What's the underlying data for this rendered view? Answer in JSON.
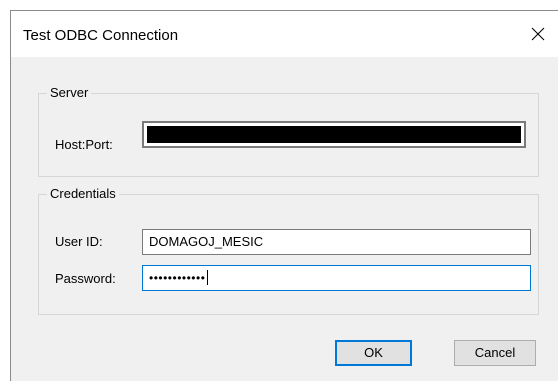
{
  "window": {
    "title": "Test ODBC Connection",
    "close_icon": "close-icon"
  },
  "server": {
    "group_label": "Server",
    "host_label": "Host:Port:",
    "host_value": ""
  },
  "credentials": {
    "group_label": "Credentials",
    "user_label": "User ID:",
    "user_value": "DOMAGOJ_MESIC",
    "password_label": "Password:",
    "password_value": "••••••••••••"
  },
  "buttons": {
    "ok_label": "OK",
    "cancel_label": "Cancel"
  },
  "colors": {
    "focus_accent": "#0078d7",
    "dialog_background": "#f0f0f0"
  }
}
